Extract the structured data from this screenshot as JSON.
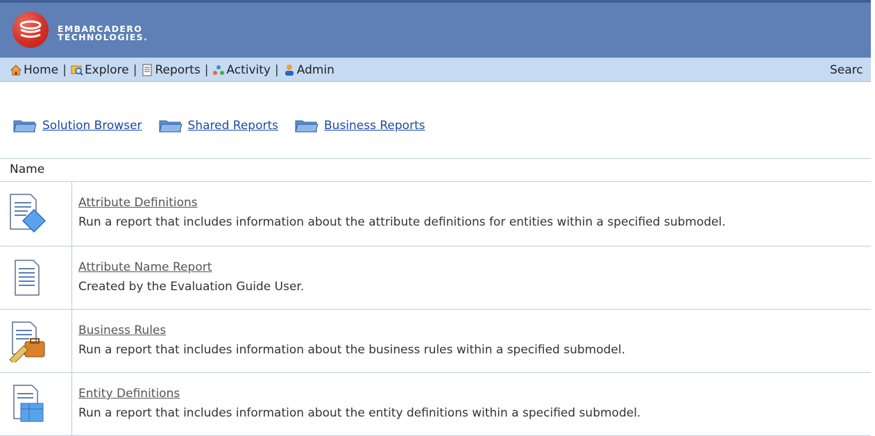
{
  "brand": {
    "line1": "EMBARCADERO",
    "line2": "TECHNOLOGIES."
  },
  "nav": {
    "items": [
      {
        "label": "Home",
        "icon": "home-icon"
      },
      {
        "label": "Explore",
        "icon": "explore-icon"
      },
      {
        "label": "Reports",
        "icon": "reports-icon"
      },
      {
        "label": "Activity",
        "icon": "activity-icon"
      },
      {
        "label": "Admin",
        "icon": "admin-icon"
      }
    ],
    "separator": "|",
    "search_label": "Searc"
  },
  "folders": [
    {
      "label": "Solution Browser"
    },
    {
      "label": "Shared Reports"
    },
    {
      "label": "Business Reports"
    }
  ],
  "table": {
    "header": "Name",
    "rows": [
      {
        "title": "Attribute Definitions",
        "desc": "Run a report that includes information about the attribute definitions for entities within a specified submodel.",
        "icon": "report-diamond-icon"
      },
      {
        "title": "Attribute Name Report",
        "desc": "Created by the Evaluation Guide User.",
        "icon": "document-icon"
      },
      {
        "title": "Business Rules",
        "desc": "Run a report that includes information about the business rules within a specified submodel.",
        "icon": "report-briefcase-icon"
      },
      {
        "title": "Entity Definitions",
        "desc": "Run a report that includes information about the entity definitions within a specified submodel.",
        "icon": "report-table-icon"
      }
    ]
  },
  "colors": {
    "header": "#5e80b6",
    "nav": "#c6daf2",
    "link": "#1a49a8",
    "grid": "#b8cde6",
    "logo": "#d23127"
  }
}
